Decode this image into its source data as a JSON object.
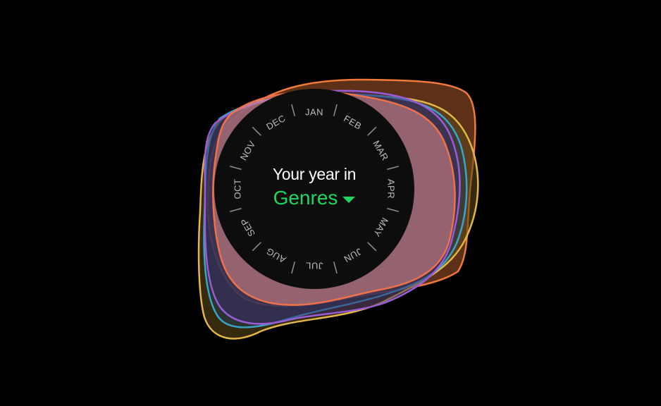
{
  "header": {
    "headline": "Your year in",
    "selected_category": "Genres"
  },
  "dial": {
    "months": [
      "JAN",
      "FEB",
      "MAR",
      "APR",
      "MAY",
      "JUN",
      "JUL",
      "AUG",
      "SEP",
      "OCT",
      "NOV",
      "DEC"
    ]
  },
  "blobs": [
    {
      "stroke": "#f07a3c",
      "fill": "#6d3a1c"
    },
    {
      "stroke": "#e2b648",
      "fill": "#5a4618"
    },
    {
      "stroke": "#3aa3c8",
      "fill": "#223a52"
    },
    {
      "stroke": "#9a5cd6",
      "fill": "#3a2a6a"
    },
    {
      "stroke": "#f0704a",
      "fill": "#e08a8a"
    }
  ],
  "colors": {
    "background": "#000000",
    "dial": "#0d0d0d",
    "accent": "#1ed760"
  },
  "icons": {
    "caret": "caret-down-icon"
  }
}
